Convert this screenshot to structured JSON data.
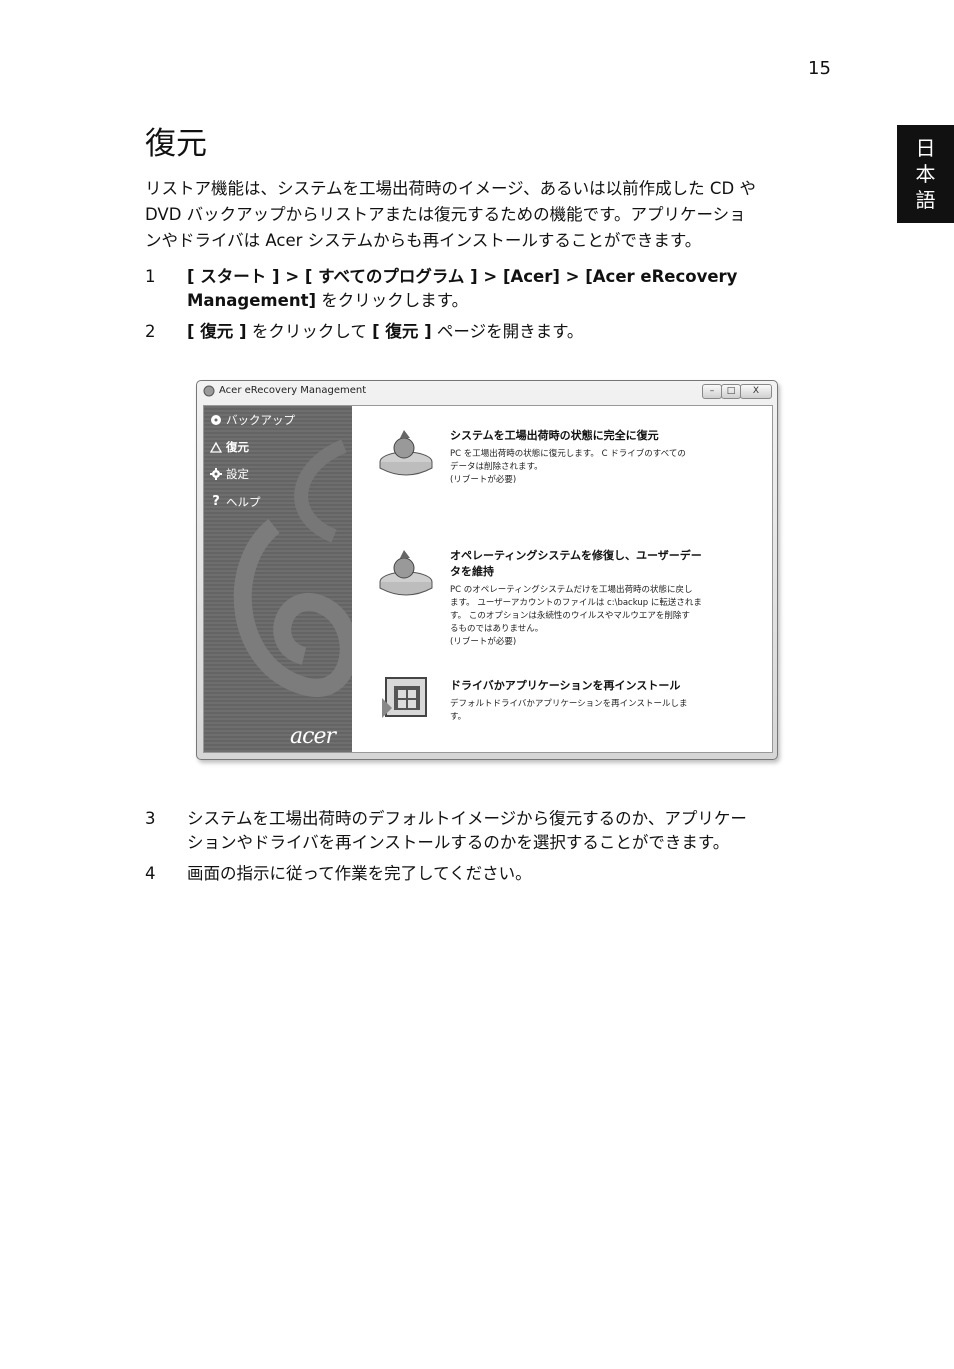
{
  "page_number": "15",
  "language_tab": [
    "日",
    "本",
    "語"
  ],
  "title": "復元",
  "intro": [
    "リストア機能は、システムを工場出荷時のイメージ、あるいは以前作成した CD や",
    "DVD バックアップからリストアまたは復元するための機能です。アプリケーショ",
    "ンやドライバは Acer システムからも再インストールすることができます。"
  ],
  "steps": [
    {
      "num": "1",
      "bold": "[ スタート ] > [ すべてのプログラム ] > [Acer] > [Acer eRecovery",
      "bold2": "Management]",
      "rest": " をクリックします。"
    },
    {
      "num": "2",
      "bold": "[ 復元 ]",
      "mid": " をクリックして ",
      "bold2": "[ 復元 ]",
      "rest": " ページを開きます。"
    },
    {
      "num": "3",
      "line1": "システムを工場出荷時のデフォルトイメージから復元するのか、アプリケー",
      "line2": "ションやドライバを再インストールするのかを選択することができます。"
    },
    {
      "num": "4",
      "line1": "画面の指示に従って作業を完了してください。"
    }
  ],
  "window": {
    "title": "Acer eRecovery Management",
    "buttons": {
      "minimize": "–",
      "maximize": "□",
      "close": "X"
    },
    "sidebar": [
      {
        "label": "バックアップ",
        "icon": "disc-icon"
      },
      {
        "label": "復元",
        "icon": "restore-icon"
      },
      {
        "label": "設定",
        "icon": "gear-icon"
      },
      {
        "label": "ヘルプ",
        "icon": "help-icon"
      }
    ],
    "logo": "acer",
    "options": [
      {
        "title": "システムを工場出荷時の状態に完全に復元",
        "desc": [
          "PC を工場出荷時の状態に復元します。 C ドライブのすべての",
          "データは削除されます。",
          "(リブートが必要)"
        ]
      },
      {
        "title": [
          "オペレーティングシステムを修復し、ユーザーデー",
          "タを維持"
        ],
        "desc": [
          "PC のオペレーティングシステムだけを工場出荷時の状態に戻し",
          "ます。 ユーザーアカウントのファイルは c:\\backup に転送されま",
          "す。 このオプションは永続性のウイルスやマルウエアを削除す",
          "るものではありません。",
          "(リブートが必要)"
        ]
      },
      {
        "title": "ドライバかアプリケーションを再インストール",
        "desc": [
          "デフォルトドライバかアプリケーションを再インストールしま",
          "す。"
        ]
      }
    ]
  }
}
